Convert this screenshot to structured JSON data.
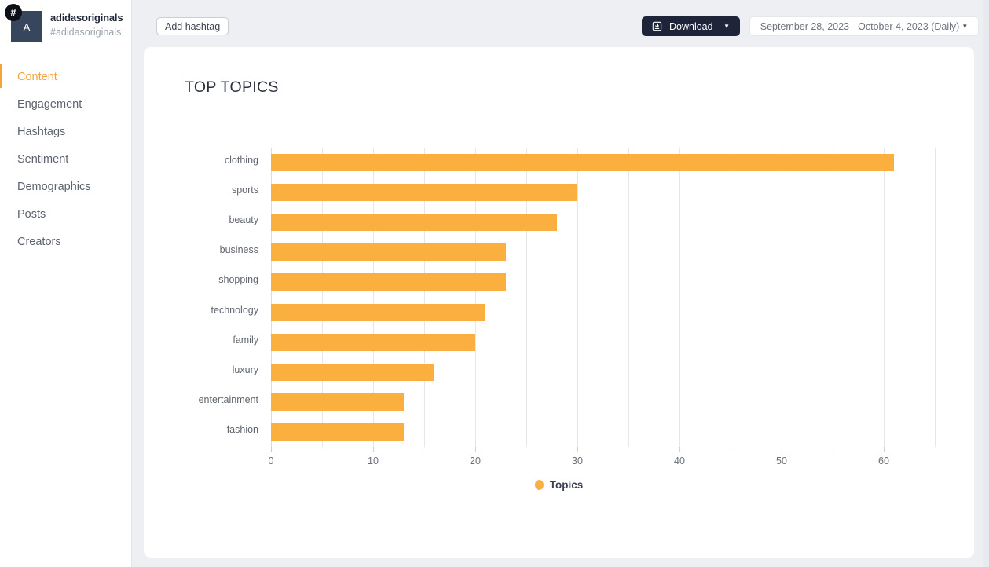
{
  "sidebar": {
    "brand": {
      "avatar_initial": "A",
      "badge_icon": "hash-icon",
      "badge_glyph": "#",
      "name": "adidasoriginals",
      "handle": "#adidasoriginals"
    },
    "items": [
      {
        "label": "Content",
        "active": true
      },
      {
        "label": "Engagement",
        "active": false
      },
      {
        "label": "Hashtags",
        "active": false
      },
      {
        "label": "Sentiment",
        "active": false
      },
      {
        "label": "Demographics",
        "active": false
      },
      {
        "label": "Posts",
        "active": false
      },
      {
        "label": "Creators",
        "active": false
      }
    ],
    "active_color": "#f3a43c"
  },
  "topbar": {
    "add_hashtag_label": "Add hashtag",
    "download_label": "Download",
    "download_icon": "download-icon",
    "download_caret": "▼",
    "date_range_label": "September 28, 2023 - October 4, 2023 (Daily)",
    "date_range_caret": "▼"
  },
  "card": {
    "title": "TOP TOPICS"
  },
  "chart_data": {
    "type": "bar",
    "orientation": "horizontal",
    "title": "TOP TOPICS",
    "xlabel": "",
    "ylabel": "",
    "categories": [
      "clothing",
      "sports",
      "beauty",
      "business",
      "shopping",
      "technology",
      "family",
      "luxury",
      "entertainment",
      "fashion"
    ],
    "values": [
      61,
      30,
      28,
      23,
      23,
      21,
      20,
      16,
      13,
      13
    ],
    "series": [
      {
        "name": "Topics",
        "color": "#fbaf3e",
        "values": [
          61,
          30,
          28,
          23,
          23,
          21,
          20,
          16,
          13,
          13
        ]
      }
    ],
    "xlim": [
      0,
      65
    ],
    "xticks": [
      0,
      10,
      20,
      30,
      40,
      50,
      60
    ],
    "xtick_labels": [
      "0",
      "10",
      "20",
      "30",
      "40",
      "50",
      "60"
    ],
    "gridlines": [
      0,
      5,
      10,
      15,
      20,
      25,
      30,
      35,
      40,
      45,
      50,
      55,
      60,
      65
    ],
    "grid": true,
    "legend": {
      "position": "bottom",
      "entries": [
        {
          "label": "Topics",
          "color": "#fbaf3e"
        }
      ]
    }
  },
  "colors": {
    "accent": "#f3a43c",
    "bar": "#fbaf3e",
    "dark": "#1e2439",
    "page_bg": "#edeff2",
    "avatar_bg": "#37465c"
  }
}
